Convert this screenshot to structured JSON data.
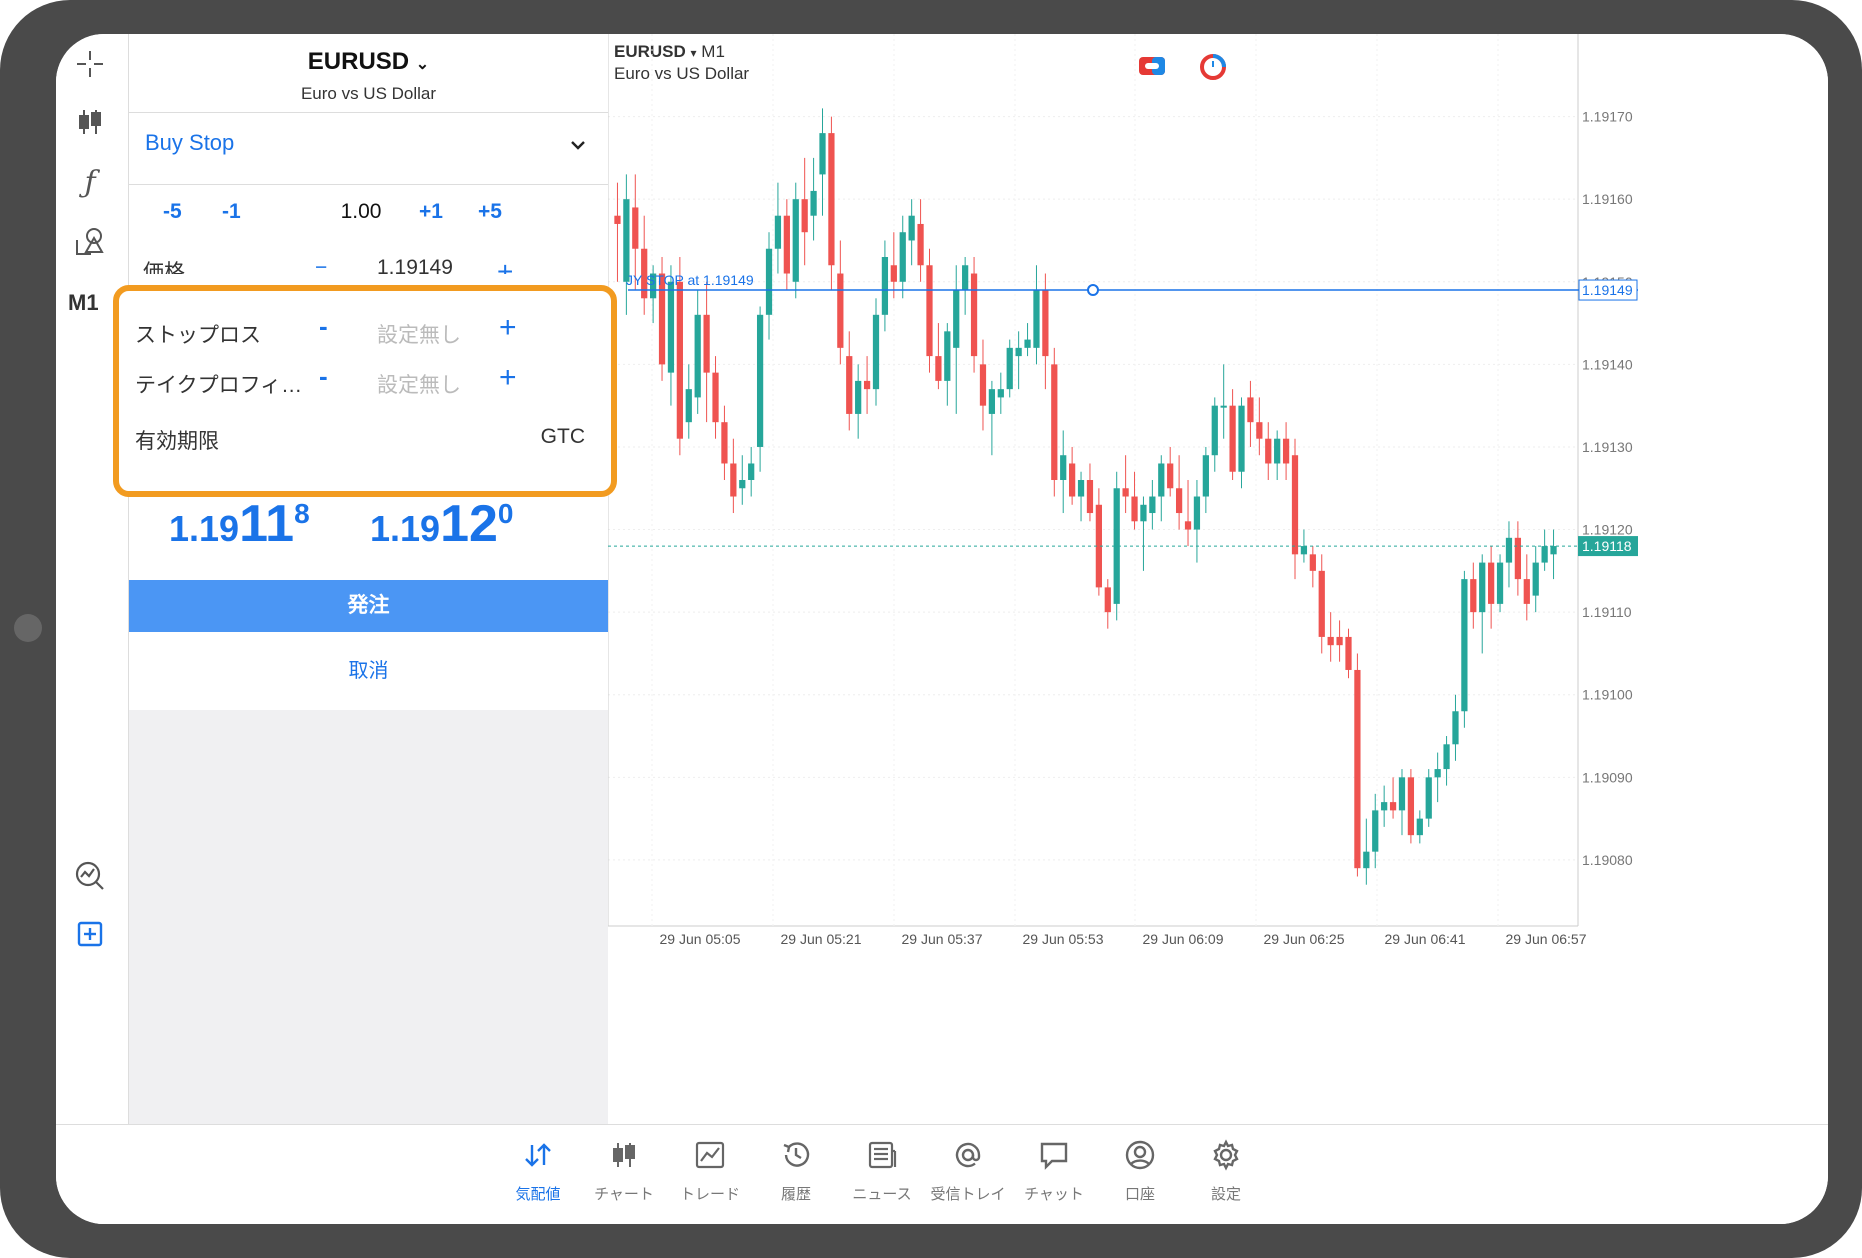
{
  "left_toolbar": {
    "timeframe": "M1",
    "icons": [
      "crosshair-icon",
      "candlestick-icon",
      "indicator-icon",
      "objects-icon",
      "timeframe-label",
      "analytics-icon",
      "new-order-icon"
    ]
  },
  "order_panel": {
    "symbol": "EURUSD",
    "symbol_desc": "Euro vs US Dollar",
    "order_type": "Buy Stop",
    "volume": {
      "dec5": "-5",
      "dec1": "-1",
      "value": "1.00",
      "inc1": "+1",
      "inc5": "+5"
    },
    "price": {
      "label": "価格",
      "minus": "−",
      "value": "1.19149",
      "plus": "+"
    },
    "stop_loss": {
      "label": "ストップロス",
      "minus": "-",
      "placeholder": "設定無し",
      "plus": "+"
    },
    "take_profit": {
      "label": "テイクプロフィ…",
      "minus": "-",
      "placeholder": "設定無し",
      "plus": "+"
    },
    "expiration": {
      "label": "有効期限",
      "value": "GTC"
    },
    "bid": {
      "small": "1.19",
      "big": "11",
      "sup": "8"
    },
    "ask": {
      "small": "1.19",
      "big": "12",
      "sup": "0"
    },
    "place_label": "発注",
    "cancel_label": "取消",
    "colors": {
      "accent": "#1a73e8",
      "highlight": "#f29b20",
      "button": "#4b96f4"
    }
  },
  "chart": {
    "symbol": "EURUSD",
    "symbol_arrow": "▾",
    "timeframe": "M1",
    "description": "Euro vs US Dollar",
    "order_line_label": "JY STOP    at 1.19149",
    "order_line_price": "1.19149",
    "bid_price": "1.19118",
    "colors": {
      "up": "#26a69a",
      "down": "#ef5350",
      "order_line": "#1a73e8",
      "bid_line": "#26a69a"
    }
  },
  "chart_data": {
    "type": "candlestick",
    "y_ticks": [
      "1.19170",
      "1.19160",
      "1.19150",
      "1.19140",
      "1.19130",
      "1.19120",
      "1.19110",
      "1.19100",
      "1.19090",
      "1.19080"
    ],
    "ylim": [
      1.19072,
      1.1918
    ],
    "x_ticks": [
      "29 Jun 05:05",
      "29 Jun 05:21",
      "29 Jun 05:37",
      "29 Jun 05:53",
      "29 Jun 06:09",
      "29 Jun 06:25",
      "29 Jun 06:41",
      "29 Jun 06:57"
    ],
    "candles_ohlc": [
      [
        1.19158,
        1.19162,
        1.1915,
        1.19157
      ],
      [
        1.1915,
        1.19163,
        1.19146,
        1.1916
      ],
      [
        1.19159,
        1.19163,
        1.19149,
        1.19154
      ],
      [
        1.19154,
        1.19158,
        1.19146,
        1.19148
      ],
      [
        1.19148,
        1.19152,
        1.19145,
        1.19151
      ],
      [
        1.19151,
        1.19153,
        1.19138,
        1.1914
      ],
      [
        1.19139,
        1.19152,
        1.19135,
        1.1915
      ],
      [
        1.1915,
        1.19153,
        1.19129,
        1.19131
      ],
      [
        1.19133,
        1.1914,
        1.19131,
        1.19137
      ],
      [
        1.19136,
        1.19149,
        1.19134,
        1.19146
      ],
      [
        1.19146,
        1.1915,
        1.19133,
        1.19139
      ],
      [
        1.19139,
        1.19141,
        1.19131,
        1.19133
      ],
      [
        1.19133,
        1.19135,
        1.19126,
        1.19128
      ],
      [
        1.19128,
        1.19131,
        1.19122,
        1.19124
      ],
      [
        1.19125,
        1.19129,
        1.19123,
        1.19126
      ],
      [
        1.19126,
        1.1913,
        1.19124,
        1.19128
      ],
      [
        1.1913,
        1.19147,
        1.19127,
        1.19146
      ],
      [
        1.19146,
        1.19156,
        1.19143,
        1.19154
      ],
      [
        1.19154,
        1.19162,
        1.19151,
        1.19158
      ],
      [
        1.19158,
        1.1916,
        1.19149,
        1.19151
      ],
      [
        1.1915,
        1.19162,
        1.19148,
        1.1916
      ],
      [
        1.1916,
        1.19165,
        1.19152,
        1.19156
      ],
      [
        1.19158,
        1.19165,
        1.19155,
        1.19161
      ],
      [
        1.19163,
        1.19171,
        1.19158,
        1.19168
      ],
      [
        1.19168,
        1.1917,
        1.19149,
        1.19152
      ],
      [
        1.19151,
        1.19155,
        1.1914,
        1.19142
      ],
      [
        1.19141,
        1.19144,
        1.19132,
        1.19134
      ],
      [
        1.19134,
        1.1914,
        1.19131,
        1.19138
      ],
      [
        1.19138,
        1.19141,
        1.19134,
        1.19137
      ],
      [
        1.19137,
        1.19148,
        1.19135,
        1.19146
      ],
      [
        1.19146,
        1.19155,
        1.19144,
        1.19153
      ],
      [
        1.19152,
        1.19156,
        1.19148,
        1.1915
      ],
      [
        1.1915,
        1.19158,
        1.19148,
        1.19156
      ],
      [
        1.19155,
        1.1916,
        1.19152,
        1.19158
      ],
      [
        1.19157,
        1.1916,
        1.1915,
        1.19152
      ],
      [
        1.19152,
        1.19154,
        1.19139,
        1.19141
      ],
      [
        1.19141,
        1.19145,
        1.19137,
        1.19138
      ],
      [
        1.19138,
        1.19145,
        1.19135,
        1.19144
      ],
      [
        1.19142,
        1.19152,
        1.19134,
        1.19149
      ],
      [
        1.19149,
        1.19153,
        1.19146,
        1.19152
      ],
      [
        1.19151,
        1.19153,
        1.19139,
        1.19141
      ],
      [
        1.1914,
        1.19143,
        1.19132,
        1.19135
      ],
      [
        1.19134,
        1.19138,
        1.19129,
        1.19137
      ],
      [
        1.19136,
        1.19139,
        1.19134,
        1.19137
      ],
      [
        1.19137,
        1.19143,
        1.19136,
        1.19142
      ],
      [
        1.19141,
        1.19144,
        1.19137,
        1.19142
      ],
      [
        1.19142,
        1.19145,
        1.19141,
        1.19143
      ],
      [
        1.19142,
        1.19152,
        1.1914,
        1.19149
      ],
      [
        1.19149,
        1.19151,
        1.19137,
        1.19141
      ],
      [
        1.1914,
        1.19142,
        1.19124,
        1.19126
      ],
      [
        1.19126,
        1.19132,
        1.19122,
        1.19129
      ],
      [
        1.19128,
        1.1913,
        1.19123,
        1.19124
      ],
      [
        1.19124,
        1.19127,
        1.19121,
        1.19126
      ],
      [
        1.19126,
        1.19128,
        1.19121,
        1.19122
      ],
      [
        1.19123,
        1.19125,
        1.19112,
        1.19113
      ],
      [
        1.19113,
        1.19114,
        1.19108,
        1.1911
      ],
      [
        1.19111,
        1.19127,
        1.19109,
        1.19125
      ],
      [
        1.19125,
        1.19129,
        1.19122,
        1.19124
      ],
      [
        1.19124,
        1.19127,
        1.1912,
        1.19121
      ],
      [
        1.19121,
        1.19124,
        1.19115,
        1.19123
      ],
      [
        1.19122,
        1.19126,
        1.1912,
        1.19124
      ],
      [
        1.19124,
        1.19129,
        1.19121,
        1.19128
      ],
      [
        1.19128,
        1.1913,
        1.19124,
        1.19125
      ],
      [
        1.19125,
        1.19129,
        1.1912,
        1.19122
      ],
      [
        1.19121,
        1.19126,
        1.19118,
        1.1912
      ],
      [
        1.1912,
        1.19126,
        1.19116,
        1.19124
      ],
      [
        1.19124,
        1.1913,
        1.19122,
        1.19129
      ],
      [
        1.19129,
        1.19136,
        1.19127,
        1.19135
      ],
      [
        1.19135,
        1.1914,
        1.19131,
        1.19135
      ],
      [
        1.19135,
        1.19137,
        1.19126,
        1.19127
      ],
      [
        1.19127,
        1.19136,
        1.19125,
        1.19135
      ],
      [
        1.19136,
        1.19138,
        1.1913,
        1.19133
      ],
      [
        1.19133,
        1.19136,
        1.19129,
        1.19131
      ],
      [
        1.19131,
        1.19133,
        1.19126,
        1.19128
      ],
      [
        1.19128,
        1.19132,
        1.19126,
        1.19131
      ],
      [
        1.19131,
        1.19133,
        1.19126,
        1.19128
      ],
      [
        1.19129,
        1.19131,
        1.19114,
        1.19117
      ],
      [
        1.19117,
        1.1912,
        1.19116,
        1.19118
      ],
      [
        1.19117,
        1.19118,
        1.19113,
        1.19115
      ],
      [
        1.19115,
        1.19117,
        1.19105,
        1.19107
      ],
      [
        1.19107,
        1.1911,
        1.19104,
        1.19106
      ],
      [
        1.19107,
        1.19109,
        1.19104,
        1.19106
      ],
      [
        1.19107,
        1.19108,
        1.19102,
        1.19103
      ],
      [
        1.19103,
        1.19105,
        1.19078,
        1.19079
      ],
      [
        1.19079,
        1.19085,
        1.19077,
        1.19081
      ],
      [
        1.19081,
        1.19088,
        1.19079,
        1.19086
      ],
      [
        1.19086,
        1.19089,
        1.19084,
        1.19087
      ],
      [
        1.19087,
        1.1909,
        1.19085,
        1.19086
      ],
      [
        1.19086,
        1.19091,
        1.19083,
        1.1909
      ],
      [
        1.1909,
        1.19091,
        1.19082,
        1.19083
      ],
      [
        1.19083,
        1.19086,
        1.19082,
        1.19085
      ],
      [
        1.19085,
        1.19091,
        1.19084,
        1.1909
      ],
      [
        1.1909,
        1.19093,
        1.19087,
        1.19091
      ],
      [
        1.19091,
        1.19095,
        1.19089,
        1.19094
      ],
      [
        1.19094,
        1.191,
        1.19092,
        1.19098
      ],
      [
        1.19098,
        1.19115,
        1.19096,
        1.19114
      ],
      [
        1.19114,
        1.19116,
        1.19108,
        1.1911
      ],
      [
        1.1911,
        1.19117,
        1.19105,
        1.19116
      ],
      [
        1.19116,
        1.19118,
        1.19108,
        1.19111
      ],
      [
        1.19111,
        1.19117,
        1.1911,
        1.19116
      ],
      [
        1.19116,
        1.19121,
        1.19113,
        1.19119
      ],
      [
        1.19119,
        1.19121,
        1.19112,
        1.19114
      ],
      [
        1.19114,
        1.19117,
        1.19109,
        1.19111
      ],
      [
        1.19112,
        1.19118,
        1.1911,
        1.19116
      ],
      [
        1.19116,
        1.1912,
        1.19115,
        1.19118
      ],
      [
        1.19117,
        1.1912,
        1.19114,
        1.19118
      ]
    ]
  },
  "tabs": [
    {
      "label": "気配値",
      "icon": "quotes-icon",
      "active": true
    },
    {
      "label": "チャート",
      "icon": "chart-icon",
      "active": false
    },
    {
      "label": "トレード",
      "icon": "trade-icon",
      "active": false
    },
    {
      "label": "履歴",
      "icon": "history-icon",
      "active": false
    },
    {
      "label": "ニュース",
      "icon": "news-icon",
      "active": false
    },
    {
      "label": "受信トレイ",
      "icon": "mail-icon",
      "active": false
    },
    {
      "label": "チャット",
      "icon": "chat-icon",
      "active": false
    },
    {
      "label": "口座",
      "icon": "account-icon",
      "active": false
    },
    {
      "label": "設定",
      "icon": "settings-icon",
      "active": false
    }
  ]
}
